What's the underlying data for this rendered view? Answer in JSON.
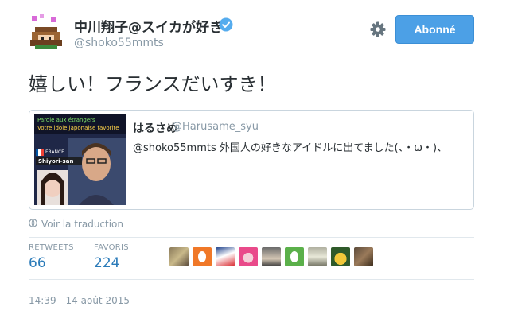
{
  "author": {
    "name": "中川翔子@スイカが好き",
    "handle": "@shoko55mmts"
  },
  "follow_button": {
    "label": "Abonné"
  },
  "tweet": {
    "text": "嬉しい！フランスだいすき！"
  },
  "quoted_tweet": {
    "name": "はるさめ",
    "handle": "@Harusame_syu",
    "text": "@shoko55mmts 外国人の好きなアイドルに出てました(、・ω・)、",
    "thumbnail": {
      "caption_line1": "Parole aux étrangers",
      "caption_line2": "Votre idole japonaise favorite",
      "flag_label": "FRANCE",
      "person_label": "Shiyori-san"
    }
  },
  "translate_link": "Voir la traduction",
  "stats": {
    "retweets_label": "RETWEETS",
    "retweets_value": "66",
    "favorites_label": "FAVORIS",
    "favorites_value": "224"
  },
  "favoriters": [
    "avatar-1",
    "avatar-2",
    "avatar-3",
    "avatar-4",
    "avatar-5",
    "avatar-6",
    "avatar-7",
    "avatar-8",
    "avatar-9"
  ],
  "timestamp": "14:39 - 14 août 2015",
  "colors": {
    "accent": "#4ca0e6",
    "link": "#2b7bb9",
    "muted": "#8899a6",
    "verified": "#55acee"
  }
}
